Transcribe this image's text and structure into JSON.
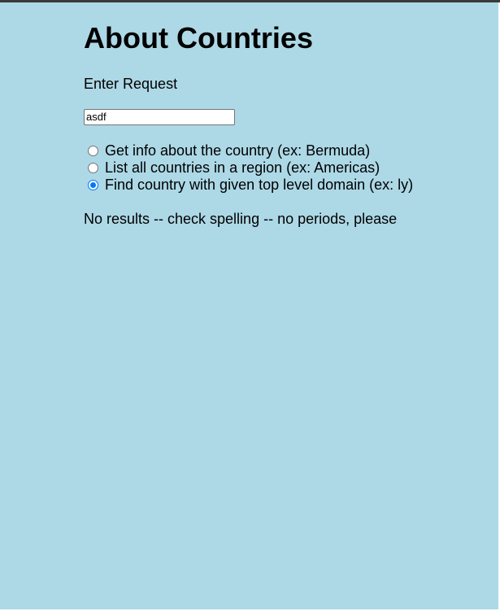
{
  "page": {
    "title": "About Countries",
    "request_label": "Enter Request",
    "input_value": "asdf",
    "options": [
      {
        "label": "Get info about the country (ex: Bermuda)",
        "checked": false
      },
      {
        "label": "List all countries in a region (ex: Americas)",
        "checked": false
      },
      {
        "label": "Find country with given top level domain (ex: ly)",
        "checked": true
      }
    ],
    "result_message": "No results -- check spelling -- no periods, please"
  },
  "colors": {
    "background": "#add8e6",
    "radio_selected": "#0075ff"
  }
}
